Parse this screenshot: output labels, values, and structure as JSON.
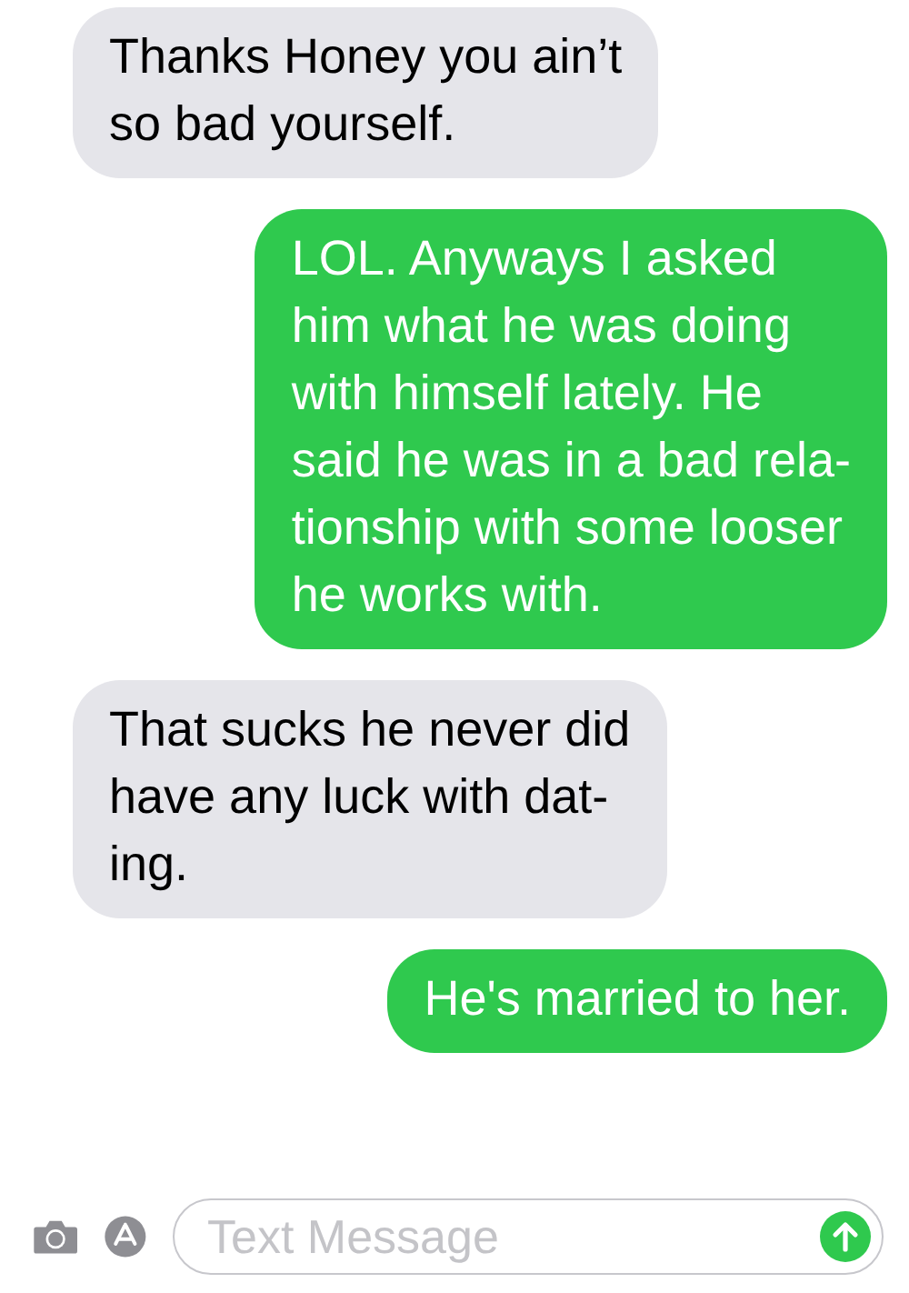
{
  "messages": [
    {
      "kind": "received",
      "lines": [
        "Thanks Honey you ain’t",
        "so bad yourself."
      ]
    },
    {
      "kind": "sent",
      "lines": [
        "LOL. Anyways I asked",
        "him what he was doing",
        "with himself lately. He",
        "said he was in a bad rela-",
        "tionship with some looser",
        "he works with."
      ]
    },
    {
      "kind": "received",
      "lines": [
        "That sucks he never did",
        "have any luck with dat-",
        "ing."
      ]
    },
    {
      "kind": "sent",
      "lines": [
        "He's married to her."
      ]
    }
  ],
  "composer": {
    "placeholder": "Text Message"
  }
}
